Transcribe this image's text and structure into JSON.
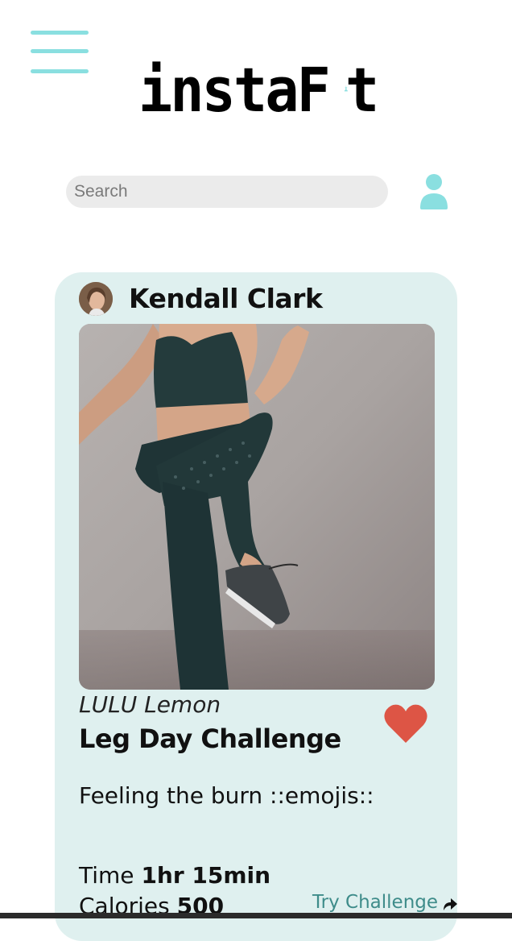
{
  "header": {
    "logo_text_left": "instaF",
    "logo_text_right": "t",
    "menu_icon": "hamburger-menu-icon",
    "profile_icon": "user-icon"
  },
  "search": {
    "placeholder": "Search",
    "value": ""
  },
  "post": {
    "author": "Kendall Clark",
    "brand": "LULU Lemon",
    "title": "Leg Day Challenge",
    "caption": "Feeling the burn ::emojis::",
    "time_label": "Time",
    "time_value": "1hr 15min",
    "calories_label": "Calories",
    "calories_value": "500",
    "try_label": "Try Challenge",
    "like_icon": "heart-icon",
    "share_icon": "share-arrow-icon"
  },
  "colors": {
    "accent": "#8adfe0",
    "card_background": "#dff0ef",
    "heart": "#dd5545",
    "link": "#3e8c8a",
    "search_background": "#ebebeb"
  }
}
